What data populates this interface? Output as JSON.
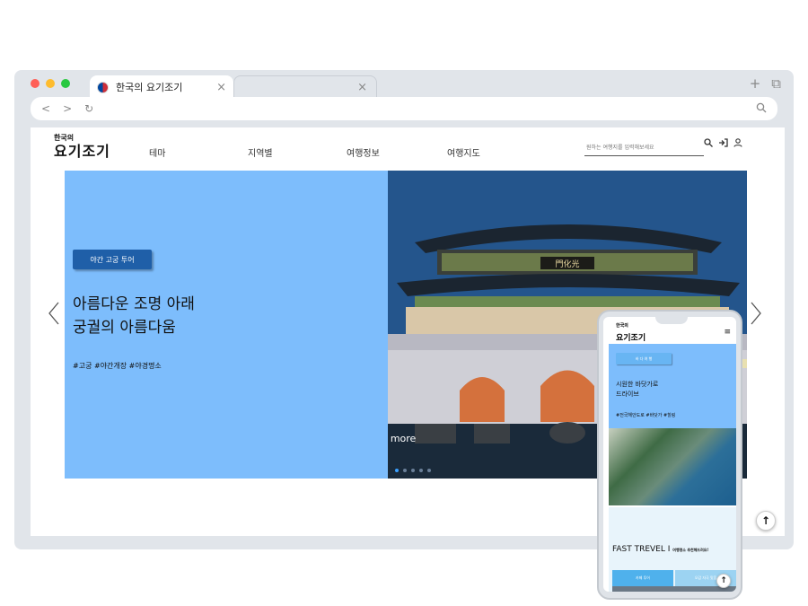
{
  "browser": {
    "traffic_lights": [
      "#ff5f57",
      "#febc2e",
      "#28c840"
    ],
    "tab_title": "한국의 요기조기",
    "tab_close": "×",
    "second_tab_close": "×",
    "new_tab": "+",
    "nav_back": "<",
    "nav_forward": ">",
    "reload": "↻"
  },
  "site": {
    "logo_small": "한국의",
    "logo_big": "요기조기",
    "nav": [
      "테마",
      "지역별",
      "여행정보",
      "여행지도"
    ],
    "search_placeholder": "원하는 여행지를 입력해보세요",
    "hero": {
      "badge": "야간 고궁 투어",
      "headline_line1": "아름다운 조명 아래",
      "headline_line2": "궁궐의 아름다움",
      "tags": "#고궁 #야간개장 #야경명소",
      "view_more": "view more",
      "image_alt": "광화문 야경",
      "gate_sign": "門化光",
      "slide_count": 5,
      "active_slide": 0
    },
    "scroll_top": "↑"
  },
  "mobile": {
    "logo_small": "한국의",
    "logo_big": "요기조기",
    "menu": "≡",
    "badge": "바 다 여 행",
    "headline_line1": "시원한 바닷가로",
    "headline_line2": "드라이브",
    "tags": "#전국해안도로 #바닷가 #힐링",
    "section_title": "FAST TREVEL I",
    "section_sub": "여행명소 추천해드려요!",
    "tabs": [
      "카페 투어",
      "오감 자극 맛집"
    ],
    "scroll_top": "↑"
  },
  "colors": {
    "hero_bg": "#7dbdfc",
    "badge_bg": "#1f5fa8",
    "browser_chrome": "#e1e5ea"
  }
}
